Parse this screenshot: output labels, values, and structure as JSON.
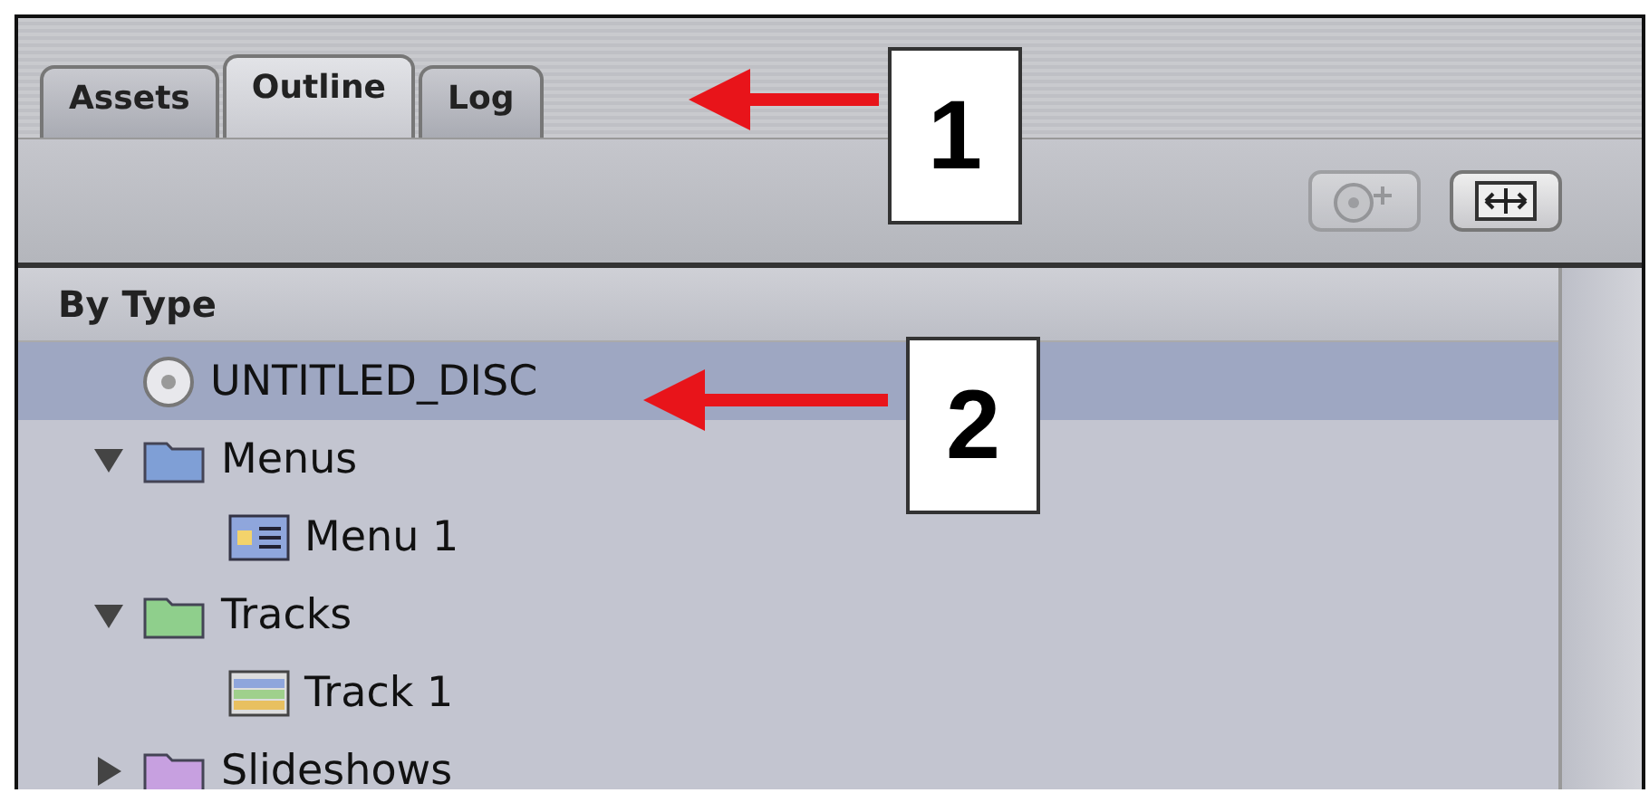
{
  "tabs": [
    {
      "label": "Assets",
      "selected": false
    },
    {
      "label": "Outline",
      "selected": true
    },
    {
      "label": "Log",
      "selected": false
    }
  ],
  "toolbar": {
    "buttons": [
      {
        "kind": "add-disc",
        "disabled": true
      },
      {
        "kind": "fit",
        "disabled": false
      }
    ]
  },
  "outline": {
    "header": "By Type",
    "items": [
      {
        "kind": "disc",
        "label": "UNTITLED_DISC",
        "selected": true
      },
      {
        "kind": "folder",
        "label": "Menus",
        "color": "#7f9fd6",
        "expanded": true,
        "selected": false,
        "children": [
          {
            "kind": "menu",
            "label": "Menu 1",
            "selected": false
          }
        ]
      },
      {
        "kind": "folder",
        "label": "Tracks",
        "color": "#8fcf8c",
        "expanded": true,
        "selected": false,
        "children": [
          {
            "kind": "track",
            "label": "Track 1",
            "selected": false
          }
        ]
      },
      {
        "kind": "folder",
        "label": "Slideshows",
        "color": "#c7a0e0",
        "expanded": false,
        "selected": false
      }
    ]
  },
  "callouts": [
    {
      "number": "1"
    },
    {
      "number": "2"
    }
  ]
}
